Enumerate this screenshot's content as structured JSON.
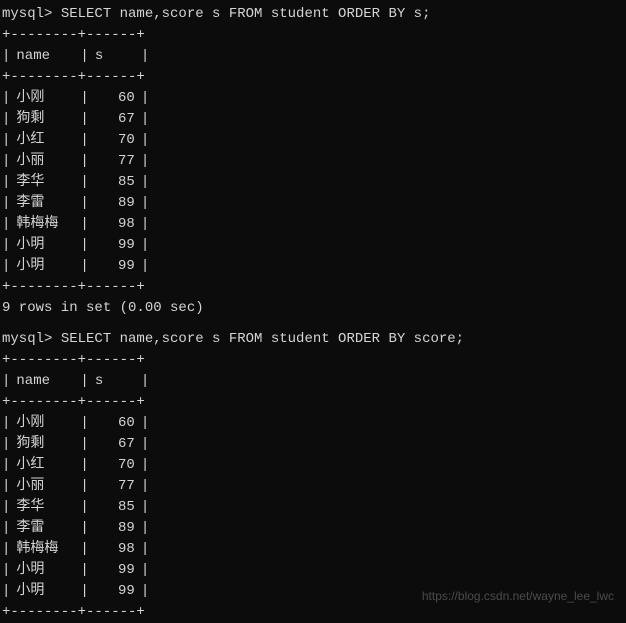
{
  "prompt": "mysql> ",
  "query1": {
    "command": "SELECT name,score s FROM student ORDER BY s;",
    "border_top": "+--------+------+",
    "border_mid": "+--------+------+",
    "border_bot": "+--------+------+",
    "headers": {
      "name": "name",
      "s": "s"
    },
    "rows": [
      {
        "name": "小刚",
        "s": "60"
      },
      {
        "name": "狗剩",
        "s": "67"
      },
      {
        "name": "小红",
        "s": "70"
      },
      {
        "name": "小丽",
        "s": "77"
      },
      {
        "name": "李华",
        "s": "85"
      },
      {
        "name": "李雷",
        "s": "89"
      },
      {
        "name": "韩梅梅",
        "s": "98"
      },
      {
        "name": "小明",
        "s": "99"
      },
      {
        "name": "小明",
        "s": "99"
      }
    ],
    "status": "9 rows in set (0.00 sec)"
  },
  "query2": {
    "command": "SELECT name,score s FROM student ORDER BY score;",
    "border_top": "+--------+------+",
    "border_mid": "+--------+------+",
    "border_bot": "+--------+------+",
    "headers": {
      "name": "name",
      "s": "s"
    },
    "rows": [
      {
        "name": "小刚",
        "s": "60"
      },
      {
        "name": "狗剩",
        "s": "67"
      },
      {
        "name": "小红",
        "s": "70"
      },
      {
        "name": "小丽",
        "s": "77"
      },
      {
        "name": "李华",
        "s": "85"
      },
      {
        "name": "李雷",
        "s": "89"
      },
      {
        "name": "韩梅梅",
        "s": "98"
      },
      {
        "name": "小明",
        "s": "99"
      },
      {
        "name": "小明",
        "s": "99"
      }
    ]
  },
  "watermark": "https://blog.csdn.net/wayne_lee_lwc",
  "pipe": "|"
}
